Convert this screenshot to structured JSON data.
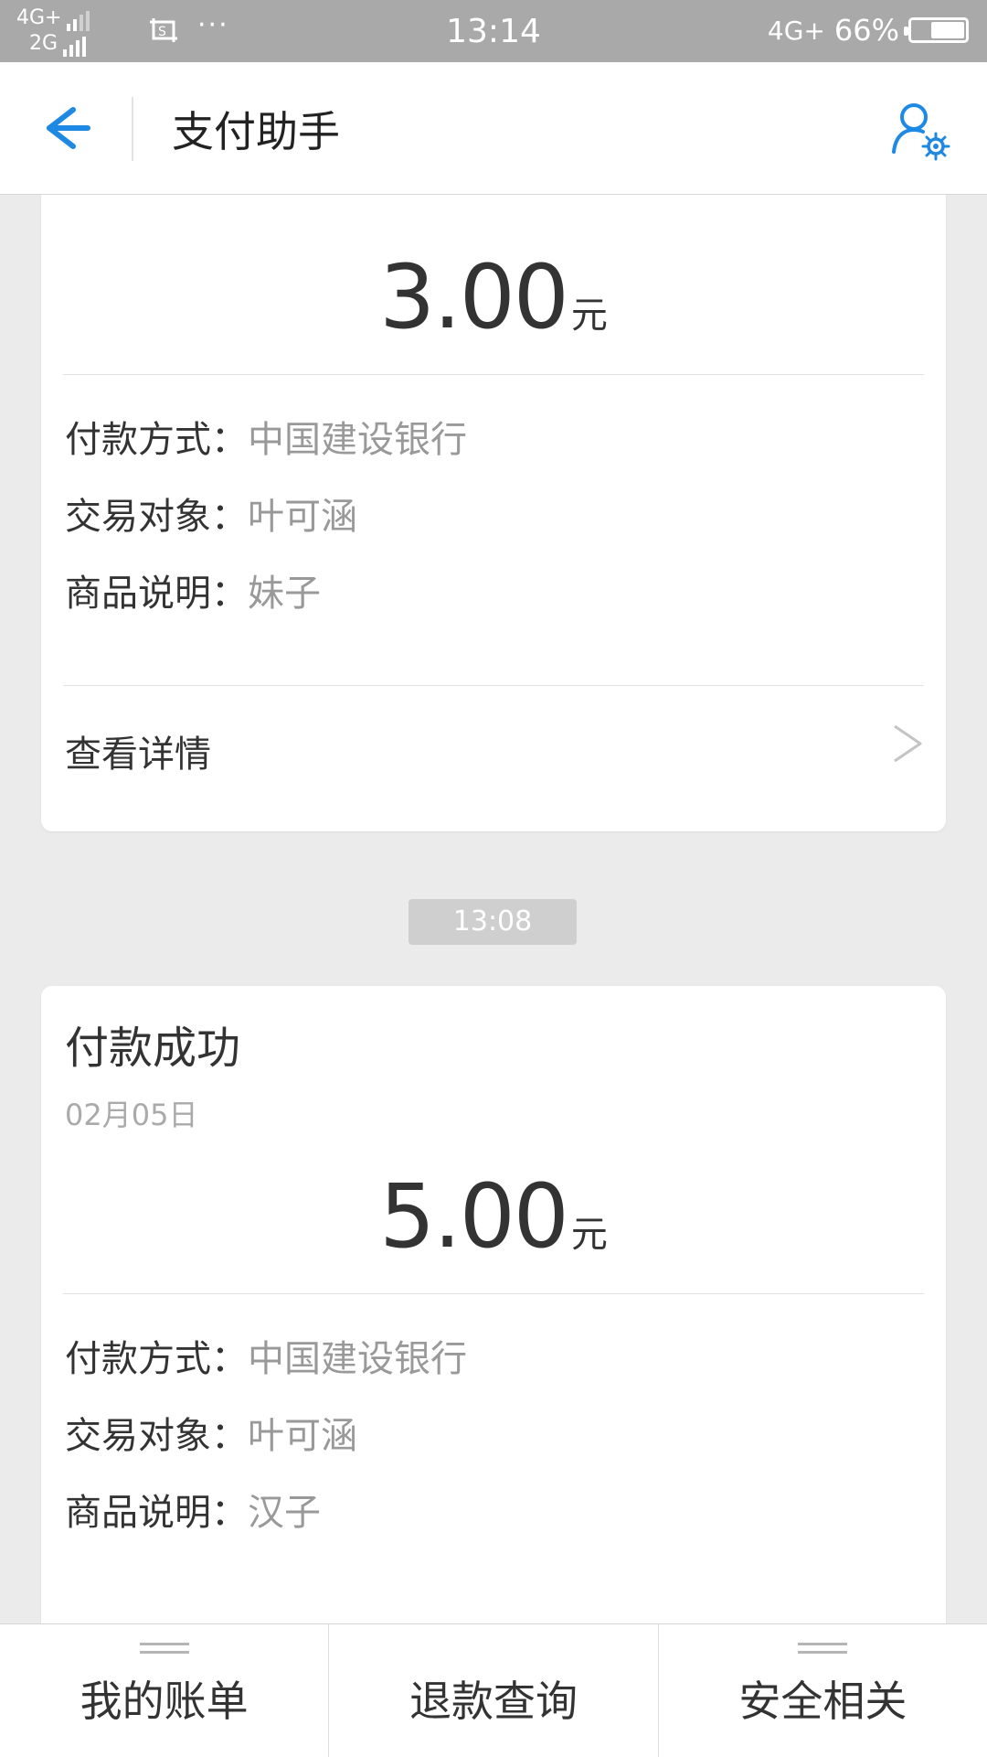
{
  "status_bar": {
    "sim1": "4G+",
    "sim2": "2G",
    "dots": "···",
    "time": "13:14",
    "network": "4G+",
    "battery": "66%",
    "battery_level": 0.66
  },
  "header": {
    "title": "支付助手",
    "back_icon": "arrow-left-icon",
    "profile_icon": "user-settings-icon",
    "accent": "#1e88e5"
  },
  "cards": [
    {
      "amount": "3.00",
      "unit": "元",
      "rows": [
        {
          "label": "付款方式：",
          "value": "中国建设银行"
        },
        {
          "label": "交易对象：",
          "value": "叶可涵"
        },
        {
          "label": "商品说明：",
          "value": "妹子"
        }
      ],
      "details_label": "查看详情"
    },
    {
      "title": "付款成功",
      "date": "02月05日",
      "amount": "5.00",
      "unit": "元",
      "rows": [
        {
          "label": "付款方式：",
          "value": "中国建设银行"
        },
        {
          "label": "交易对象：",
          "value": "叶可涵"
        },
        {
          "label": "商品说明：",
          "value": "汉子"
        }
      ]
    }
  ],
  "timestamp_divider": "13:08",
  "tabs": [
    {
      "label": "我的账单"
    },
    {
      "label": "退款查询"
    },
    {
      "label": "安全相关"
    }
  ]
}
